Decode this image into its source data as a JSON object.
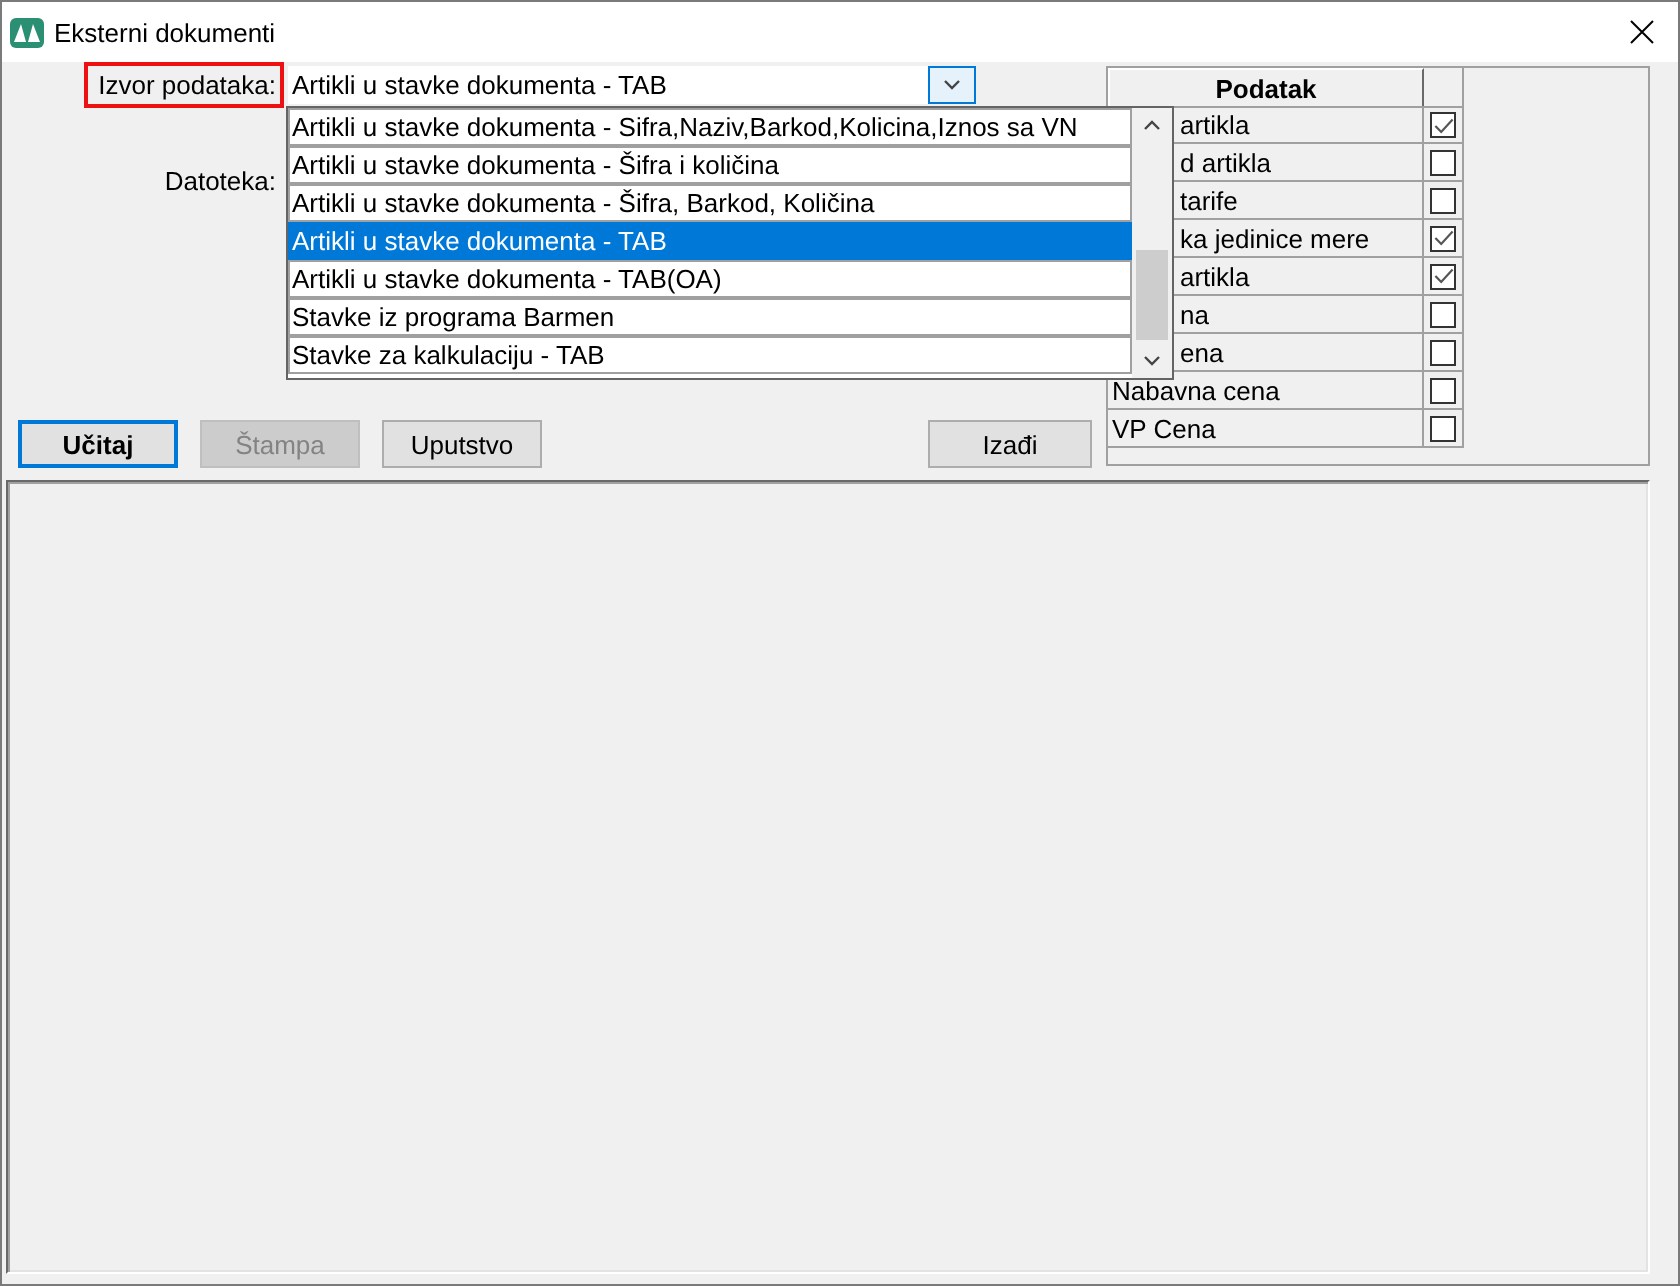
{
  "window": {
    "title": "Eksterni dokumenti"
  },
  "source": {
    "label": "Izvor podataka:",
    "highlighted": true,
    "value": "Artikli u stavke dokumenta - TAB",
    "expanded": true,
    "options": [
      {
        "label": "Artikli u stavke dokumenta - Sifra,Naziv,Barkod,Kolicina,Iznos sa VN",
        "selected": false
      },
      {
        "label": "Artikli u stavke dokumenta - Šifra i količina",
        "selected": false
      },
      {
        "label": "Artikli u stavke dokumenta - Šifra, Barkod, Količina",
        "selected": false
      },
      {
        "label": "Artikli u stavke dokumenta - TAB",
        "selected": true
      },
      {
        "label": "Artikli u stavke dokumenta - TAB(OA)",
        "selected": false
      },
      {
        "label": "Stavke iz programa Barmen",
        "selected": false
      },
      {
        "label": "Stavke za kalkulaciju - TAB",
        "selected": false
      }
    ]
  },
  "file": {
    "label": "Datoteka:"
  },
  "actions": [
    {
      "label": "Učitaj",
      "focused": true,
      "disabled": false
    },
    {
      "label": "Štampa",
      "focused": false,
      "disabled": true
    },
    {
      "label": "Uputstvo",
      "focused": false,
      "disabled": false
    }
  ],
  "exit_button": {
    "label": "Izađi"
  },
  "fields": {
    "column": "Podatak",
    "rows": [
      {
        "name": "artikla",
        "checked": true
      },
      {
        "name": "d artikla",
        "checked": false
      },
      {
        "name": "tarife",
        "checked": false
      },
      {
        "name": "ka jedinice mere",
        "checked": true
      },
      {
        "name": "artikla",
        "checked": true
      },
      {
        "name": "na",
        "checked": false
      },
      {
        "name": "ena",
        "checked": false
      },
      {
        "name": "Nabavna cena",
        "checked": false
      },
      {
        "name": "VP Cena",
        "checked": false
      }
    ]
  }
}
